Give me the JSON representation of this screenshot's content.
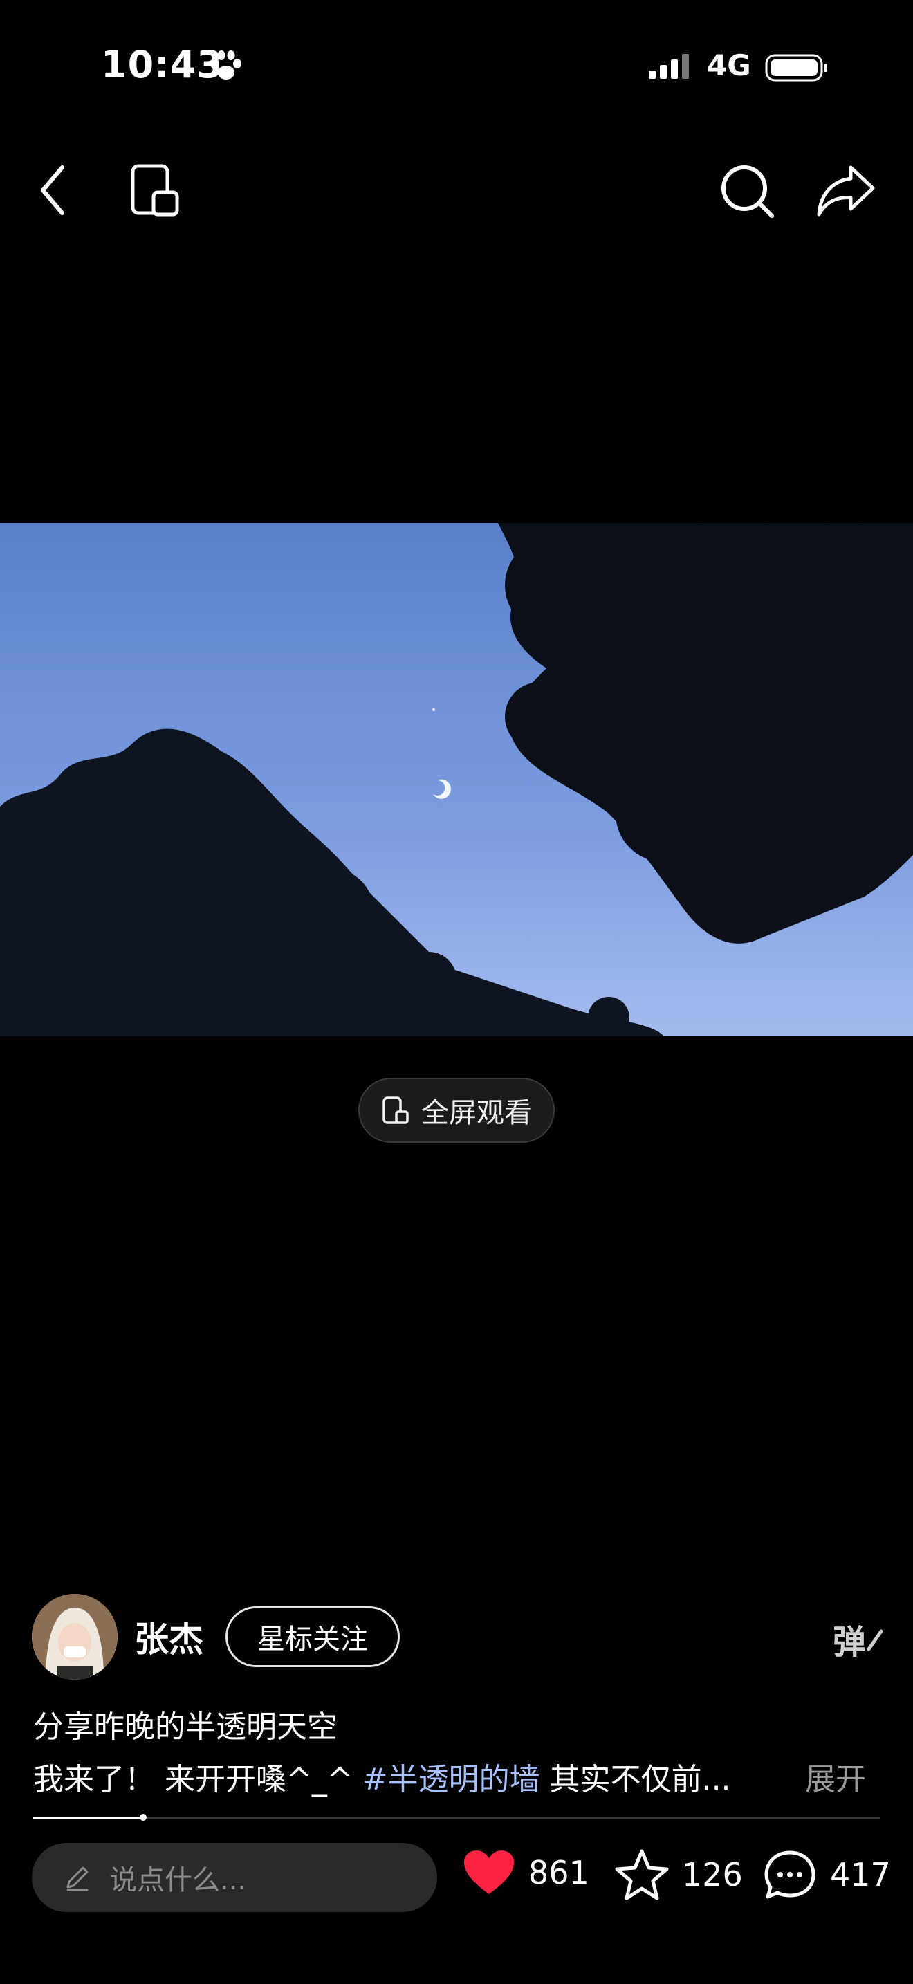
{
  "status_bar": {
    "time": "10:43",
    "network": "4G"
  },
  "nav": {
    "back_icon": "chevron-left-icon",
    "rotate_icon": "rotate-screen-icon",
    "search_icon": "search-icon",
    "share_icon": "share-icon"
  },
  "video": {
    "fullscreen_label": "全屏观看"
  },
  "author": {
    "name": "张杰",
    "follow_label": "星标关注",
    "danmaku_label": "弹"
  },
  "post": {
    "title": "分享昨晚的半透明天空",
    "desc_prefix": "我来了！ 来开开嗓^_^ ",
    "hashtag": "#半透明的墙",
    "desc_suffix": " 其实不仅前...",
    "expand_label": "展开"
  },
  "progress": {
    "fraction": 0.13
  },
  "bottom_bar": {
    "comment_placeholder": "说点什么...",
    "likes": "861",
    "favorites": "126",
    "comments": "417"
  },
  "colors": {
    "like": "#ff2442",
    "hashtag": "#a7c0ff"
  }
}
